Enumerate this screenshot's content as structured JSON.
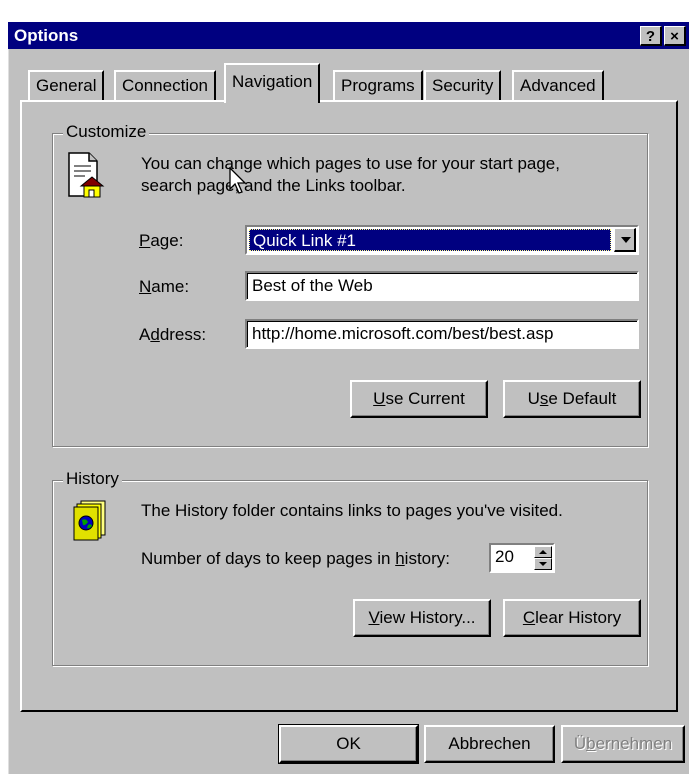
{
  "window": {
    "title": "Options",
    "help_label": "?",
    "close_label": "×"
  },
  "tabs": [
    {
      "label": "General"
    },
    {
      "label": "Connection"
    },
    {
      "label": "Navigation",
      "active": true
    },
    {
      "label": "Programs"
    },
    {
      "label": "Security"
    },
    {
      "label": "Advanced"
    }
  ],
  "customize": {
    "group_label": "Customize",
    "description_line1": "You can change which pages to use for your start page,",
    "description_line2": "search page, and the Links toolbar.",
    "page_label_pre": "",
    "page_label_u": "P",
    "page_label_post": "age:",
    "page_value": "Quick Link #1",
    "name_label_u": "N",
    "name_label_post": "ame:",
    "name_value": "Best of the Web",
    "address_label_pre": "A",
    "address_label_u": "d",
    "address_label_post": "dress:",
    "address_value": "http://home.microsoft.com/best/best.asp",
    "use_current_u": "U",
    "use_current_post": "se Current",
    "use_default_pre": "U",
    "use_default_u": "s",
    "use_default_post": "e Default"
  },
  "history": {
    "group_label": "History",
    "description": "The History folder contains links to pages you've visited.",
    "days_label_pre": "Number of days to keep pages in ",
    "days_label_u": "h",
    "days_label_post": "istory:",
    "days_value": "20",
    "view_history_u": "V",
    "view_history_post": "iew History...",
    "clear_history_u": "C",
    "clear_history_post": "lear History"
  },
  "footer": {
    "ok_label": "OK",
    "cancel_label": "Abbrechen",
    "apply_pre": "Ü",
    "apply_u": "b",
    "apply_post": "ernehmen"
  },
  "colors": {
    "titlebar": "#000080",
    "face": "#c0c0c0",
    "selection": "#000080"
  },
  "icons": {
    "customize": "page-with-house-icon",
    "history": "history-book-globe-icon",
    "cursor": "mouse-pointer-icon"
  }
}
